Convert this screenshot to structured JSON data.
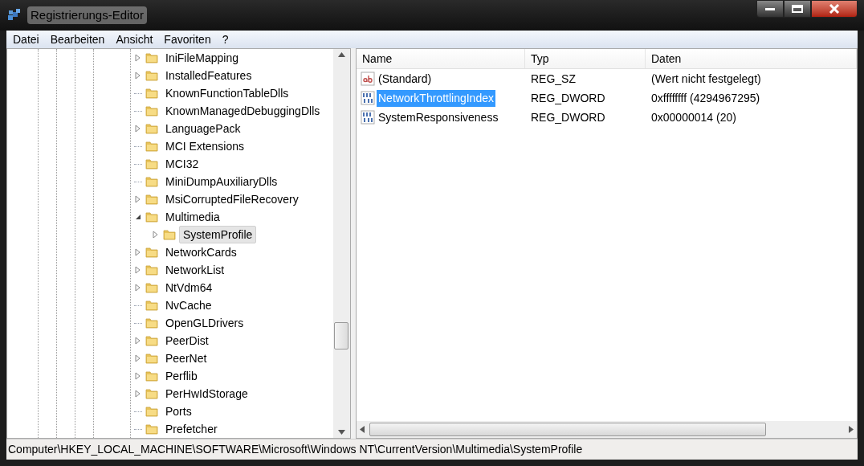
{
  "window": {
    "title": "Registrierungs-Editor"
  },
  "menu": [
    "Datei",
    "Bearbeiten",
    "Ansicht",
    "Favoriten",
    "?"
  ],
  "tree": [
    {
      "label": "IniFileMapping",
      "expandable": true,
      "expanded": false,
      "selected": false
    },
    {
      "label": "InstalledFeatures",
      "expandable": true,
      "expanded": false,
      "selected": false
    },
    {
      "label": "KnownFunctionTableDlls",
      "expandable": false,
      "expanded": false,
      "selected": false
    },
    {
      "label": "KnownManagedDebuggingDlls",
      "expandable": false,
      "expanded": false,
      "selected": false
    },
    {
      "label": "LanguagePack",
      "expandable": true,
      "expanded": false,
      "selected": false
    },
    {
      "label": "MCI Extensions",
      "expandable": false,
      "expanded": false,
      "selected": false
    },
    {
      "label": "MCI32",
      "expandable": false,
      "expanded": false,
      "selected": false
    },
    {
      "label": "MiniDumpAuxiliaryDlls",
      "expandable": false,
      "expanded": false,
      "selected": false
    },
    {
      "label": "MsiCorruptedFileRecovery",
      "expandable": true,
      "expanded": false,
      "selected": false
    },
    {
      "label": "Multimedia",
      "expandable": true,
      "expanded": true,
      "selected": false,
      "children": [
        {
          "label": "SystemProfile",
          "expandable": true,
          "expanded": false,
          "selected": true
        }
      ]
    },
    {
      "label": "NetworkCards",
      "expandable": true,
      "expanded": false,
      "selected": false
    },
    {
      "label": "NetworkList",
      "expandable": true,
      "expanded": false,
      "selected": false
    },
    {
      "label": "NtVdm64",
      "expandable": true,
      "expanded": false,
      "selected": false
    },
    {
      "label": "NvCache",
      "expandable": false,
      "expanded": false,
      "selected": false
    },
    {
      "label": "OpenGLDrivers",
      "expandable": false,
      "expanded": false,
      "selected": false
    },
    {
      "label": "PeerDist",
      "expandable": true,
      "expanded": false,
      "selected": false
    },
    {
      "label": "PeerNet",
      "expandable": true,
      "expanded": false,
      "selected": false
    },
    {
      "label": "Perflib",
      "expandable": true,
      "expanded": false,
      "selected": false
    },
    {
      "label": "PerHwIdStorage",
      "expandable": true,
      "expanded": false,
      "selected": false
    },
    {
      "label": "Ports",
      "expandable": false,
      "expanded": false,
      "selected": false
    },
    {
      "label": "Prefetcher",
      "expandable": false,
      "expanded": false,
      "selected": false
    }
  ],
  "table": {
    "columns": [
      "Name",
      "Typ",
      "Daten"
    ],
    "rows": [
      {
        "kind": "string",
        "name": "(Standard)",
        "type": "REG_SZ",
        "data": "(Wert nicht festgelegt)",
        "selected": false
      },
      {
        "kind": "binary",
        "name": "NetworkThrottlingIndex",
        "type": "REG_DWORD",
        "data": "0xffffffff (4294967295)",
        "selected": true
      },
      {
        "kind": "binary",
        "name": "SystemResponsiveness",
        "type": "REG_DWORD",
        "data": "0x00000014 (20)",
        "selected": false
      }
    ]
  },
  "status_bar": "Computer\\HKEY_LOCAL_MACHINE\\SOFTWARE\\Microsoft\\Windows NT\\CurrentVersion\\Multimedia\\SystemProfile"
}
